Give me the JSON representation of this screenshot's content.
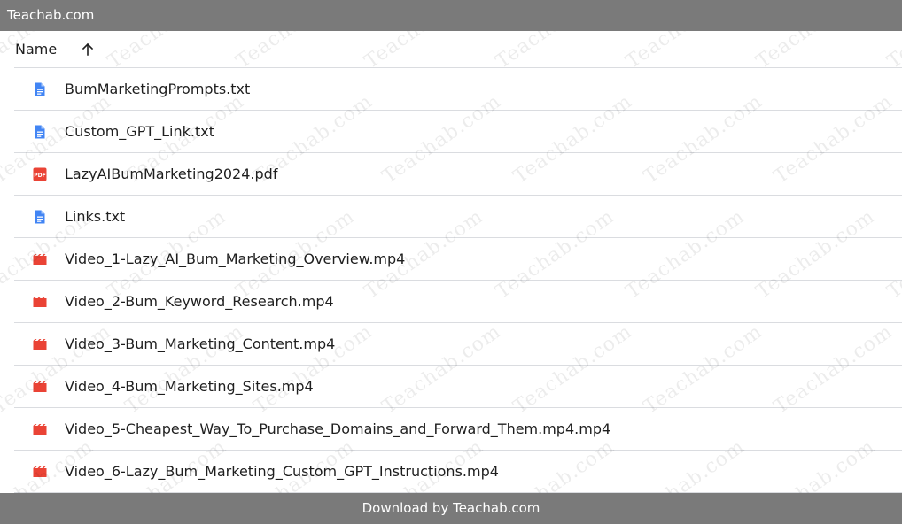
{
  "top_bar": {
    "title": "Teachab.com"
  },
  "bottom_bar": {
    "text": "Download by Teachab.com"
  },
  "list_header": {
    "column_label": "Name",
    "sort_direction_icon": "arrow-up-icon"
  },
  "watermark": {
    "text": "Teachab.com"
  },
  "files": [
    {
      "name": "BumMarketingPrompts.txt",
      "type": "doc",
      "icon": "doc-icon"
    },
    {
      "name": "Custom_GPT_Link.txt",
      "type": "doc",
      "icon": "doc-icon"
    },
    {
      "name": "LazyAIBumMarketing2024.pdf",
      "type": "pdf",
      "icon": "pdf-icon"
    },
    {
      "name": "Links.txt",
      "type": "doc",
      "icon": "doc-icon"
    },
    {
      "name": "Video_1-Lazy_AI_Bum_Marketing_Overview.mp4",
      "type": "video",
      "icon": "video-icon"
    },
    {
      "name": "Video_2-Bum_Keyword_Research.mp4",
      "type": "video",
      "icon": "video-icon"
    },
    {
      "name": "Video_3-Bum_Marketing_Content.mp4",
      "type": "video",
      "icon": "video-icon"
    },
    {
      "name": "Video_4-Bum_Marketing_Sites.mp4",
      "type": "video",
      "icon": "video-icon"
    },
    {
      "name": "Video_5-Cheapest_Way_To_Purchase_Domains_and_Forward_Them.mp4.mp4",
      "type": "video",
      "icon": "video-icon"
    },
    {
      "name": "Video_6-Lazy_Bum_Marketing_Custom_GPT_Instructions.mp4",
      "type": "video",
      "icon": "video-icon"
    }
  ],
  "colors": {
    "bar_background": "#7a7a7a",
    "doc_icon": "#4285f4",
    "pdf_icon": "#ea4335",
    "video_icon": "#ea4335",
    "divider": "#dadce0"
  }
}
